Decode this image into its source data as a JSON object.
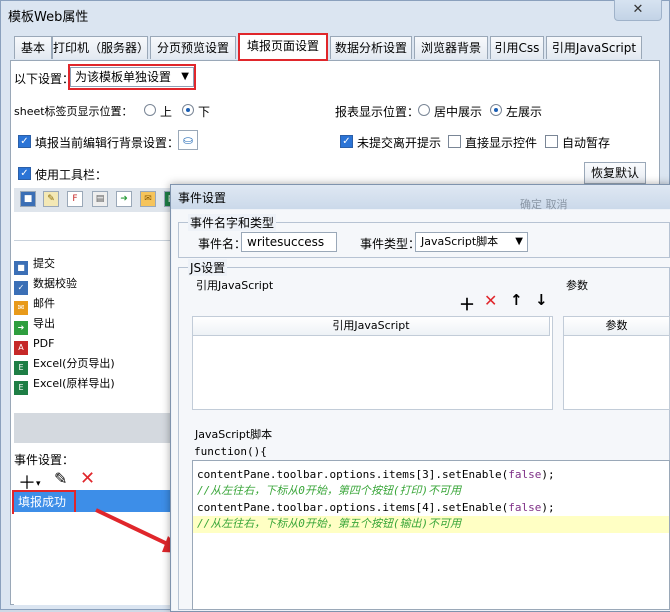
{
  "window": {
    "title": "模板Web属性",
    "close_glyph": "✕"
  },
  "tabs": [
    "基本",
    "打印机（服务器）",
    "分页预览设置",
    "填报页面设置",
    "数据分析设置",
    "浏览器背景",
    "引用Css",
    "引用JavaScript"
  ],
  "settings": {
    "scope_label": "以下设置：",
    "scope_value": "为该模板单独设置",
    "sheet_tab_label": "sheet标签页显示位置：",
    "sheet_tab_top": "上",
    "sheet_tab_bottom": "下",
    "report_pos_label": "报表显示位置：",
    "report_pos_center": "居中展示",
    "report_pos_left": "左展示",
    "fill_bg_label": "填报当前编辑行背景设置：",
    "unsubmitted_label": "未提交离开提示",
    "direct_controls_label": "直接显示控件",
    "autosave_label": "自动暂存",
    "use_toolbar_label": "使用工具栏：",
    "restore_default_label": "恢复默认"
  },
  "toolbar_buttons": [
    {
      "name": "save",
      "color": "#3b6fb6",
      "glyph": "■"
    },
    {
      "name": "edit",
      "color": "#c9a227",
      "glyph": "✎"
    },
    {
      "name": "pdf-export",
      "color": "#c62828",
      "glyph": "F"
    },
    {
      "name": "print",
      "color": "#666666",
      "glyph": "▤"
    },
    {
      "name": "export",
      "color": "#2e9e3e",
      "glyph": "➜"
    },
    {
      "name": "mail",
      "color": "#e89a1a",
      "glyph": "✉"
    },
    {
      "name": "excel",
      "color": "#1e7e45",
      "glyph": "▦"
    }
  ],
  "list_items": [
    {
      "label": "提交",
      "icon": "submit-icon",
      "color": "#3b6fb6"
    },
    {
      "label": "数据校验",
      "icon": "check-icon",
      "color": "#3b6fb6"
    },
    {
      "label": "邮件",
      "icon": "mail-icon",
      "color": "#e89a1a"
    },
    {
      "label": "导出",
      "icon": "export-icon",
      "color": "#2e9e3e"
    },
    {
      "label": "PDF",
      "icon": "pdf-icon",
      "color": "#c62828"
    },
    {
      "label": "Excel(分页导出)",
      "icon": "excel-icon",
      "color": "#1e7e45"
    },
    {
      "label": "Excel(原样导出)",
      "icon": "excel-icon",
      "color": "#1e7e45"
    }
  ],
  "events": {
    "label": "事件设置：",
    "items": [
      "填报成功"
    ]
  },
  "dialog": {
    "title": "事件设置",
    "name_type_group": "事件名字和类型",
    "event_name_label": "事件名：",
    "event_name_value": "writesuccess",
    "event_type_label": "事件类型：",
    "event_type_value": "JavaScript脚本",
    "js_group": "JS设置",
    "ref_js_label": "引用JavaScript",
    "params_label": "参数",
    "ref_js_header": "引用JavaScript",
    "params_header": "参数",
    "script_label": "JavaScript脚本",
    "function_header": "function(){",
    "faded_text": "确定 取消"
  },
  "code_lines": [
    {
      "kind": "code",
      "text": "contentPane.toolbar.options.items[3].setEnable(false);"
    },
    {
      "kind": "comment",
      "text": "//从左往右，下标从0开始，第四个按钮(打印)不可用"
    },
    {
      "kind": "code",
      "text": "contentPane.toolbar.options.items[4].setEnable(false);"
    },
    {
      "kind": "comment",
      "text": "//从左往右，下标从0开始，第五个按钮(输出)不可用"
    }
  ],
  "colors": {
    "highlight_red": "#e0262b",
    "selection_blue": "#3d8ee8",
    "comment_green": "#3aa63a",
    "keyword_purple": "#7e2f86",
    "current_line_yellow": "#ffffc4"
  }
}
